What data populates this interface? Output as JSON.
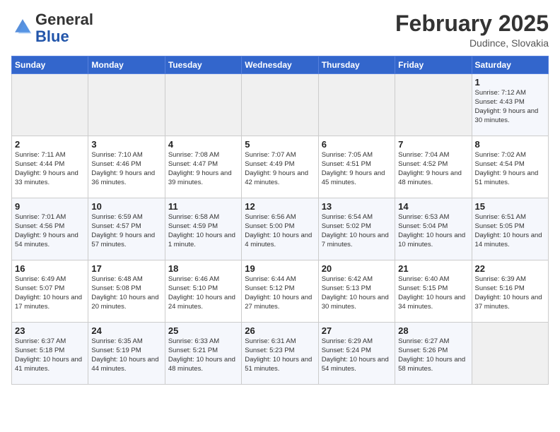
{
  "logo": {
    "general": "General",
    "blue": "Blue"
  },
  "header": {
    "month": "February 2025",
    "location": "Dudince, Slovakia"
  },
  "weekdays": [
    "Sunday",
    "Monday",
    "Tuesday",
    "Wednesday",
    "Thursday",
    "Friday",
    "Saturday"
  ],
  "weeks": [
    [
      {
        "day": "",
        "info": ""
      },
      {
        "day": "",
        "info": ""
      },
      {
        "day": "",
        "info": ""
      },
      {
        "day": "",
        "info": ""
      },
      {
        "day": "",
        "info": ""
      },
      {
        "day": "",
        "info": ""
      },
      {
        "day": "1",
        "info": "Sunrise: 7:12 AM\nSunset: 4:43 PM\nDaylight: 9 hours and 30 minutes."
      }
    ],
    [
      {
        "day": "2",
        "info": "Sunrise: 7:11 AM\nSunset: 4:44 PM\nDaylight: 9 hours and 33 minutes."
      },
      {
        "day": "3",
        "info": "Sunrise: 7:10 AM\nSunset: 4:46 PM\nDaylight: 9 hours and 36 minutes."
      },
      {
        "day": "4",
        "info": "Sunrise: 7:08 AM\nSunset: 4:47 PM\nDaylight: 9 hours and 39 minutes."
      },
      {
        "day": "5",
        "info": "Sunrise: 7:07 AM\nSunset: 4:49 PM\nDaylight: 9 hours and 42 minutes."
      },
      {
        "day": "6",
        "info": "Sunrise: 7:05 AM\nSunset: 4:51 PM\nDaylight: 9 hours and 45 minutes."
      },
      {
        "day": "7",
        "info": "Sunrise: 7:04 AM\nSunset: 4:52 PM\nDaylight: 9 hours and 48 minutes."
      },
      {
        "day": "8",
        "info": "Sunrise: 7:02 AM\nSunset: 4:54 PM\nDaylight: 9 hours and 51 minutes."
      }
    ],
    [
      {
        "day": "9",
        "info": "Sunrise: 7:01 AM\nSunset: 4:56 PM\nDaylight: 9 hours and 54 minutes."
      },
      {
        "day": "10",
        "info": "Sunrise: 6:59 AM\nSunset: 4:57 PM\nDaylight: 9 hours and 57 minutes."
      },
      {
        "day": "11",
        "info": "Sunrise: 6:58 AM\nSunset: 4:59 PM\nDaylight: 10 hours and 1 minute."
      },
      {
        "day": "12",
        "info": "Sunrise: 6:56 AM\nSunset: 5:00 PM\nDaylight: 10 hours and 4 minutes."
      },
      {
        "day": "13",
        "info": "Sunrise: 6:54 AM\nSunset: 5:02 PM\nDaylight: 10 hours and 7 minutes."
      },
      {
        "day": "14",
        "info": "Sunrise: 6:53 AM\nSunset: 5:04 PM\nDaylight: 10 hours and 10 minutes."
      },
      {
        "day": "15",
        "info": "Sunrise: 6:51 AM\nSunset: 5:05 PM\nDaylight: 10 hours and 14 minutes."
      }
    ],
    [
      {
        "day": "16",
        "info": "Sunrise: 6:49 AM\nSunset: 5:07 PM\nDaylight: 10 hours and 17 minutes."
      },
      {
        "day": "17",
        "info": "Sunrise: 6:48 AM\nSunset: 5:08 PM\nDaylight: 10 hours and 20 minutes."
      },
      {
        "day": "18",
        "info": "Sunrise: 6:46 AM\nSunset: 5:10 PM\nDaylight: 10 hours and 24 minutes."
      },
      {
        "day": "19",
        "info": "Sunrise: 6:44 AM\nSunset: 5:12 PM\nDaylight: 10 hours and 27 minutes."
      },
      {
        "day": "20",
        "info": "Sunrise: 6:42 AM\nSunset: 5:13 PM\nDaylight: 10 hours and 30 minutes."
      },
      {
        "day": "21",
        "info": "Sunrise: 6:40 AM\nSunset: 5:15 PM\nDaylight: 10 hours and 34 minutes."
      },
      {
        "day": "22",
        "info": "Sunrise: 6:39 AM\nSunset: 5:16 PM\nDaylight: 10 hours and 37 minutes."
      }
    ],
    [
      {
        "day": "23",
        "info": "Sunrise: 6:37 AM\nSunset: 5:18 PM\nDaylight: 10 hours and 41 minutes."
      },
      {
        "day": "24",
        "info": "Sunrise: 6:35 AM\nSunset: 5:19 PM\nDaylight: 10 hours and 44 minutes."
      },
      {
        "day": "25",
        "info": "Sunrise: 6:33 AM\nSunset: 5:21 PM\nDaylight: 10 hours and 48 minutes."
      },
      {
        "day": "26",
        "info": "Sunrise: 6:31 AM\nSunset: 5:23 PM\nDaylight: 10 hours and 51 minutes."
      },
      {
        "day": "27",
        "info": "Sunrise: 6:29 AM\nSunset: 5:24 PM\nDaylight: 10 hours and 54 minutes."
      },
      {
        "day": "28",
        "info": "Sunrise: 6:27 AM\nSunset: 5:26 PM\nDaylight: 10 hours and 58 minutes."
      },
      {
        "day": "",
        "info": ""
      }
    ]
  ]
}
